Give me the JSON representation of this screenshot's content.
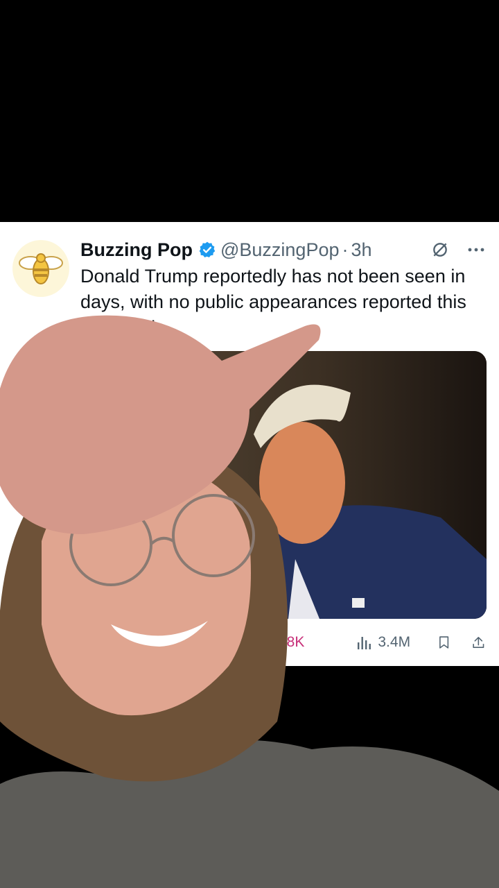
{
  "tweet": {
    "author_name": "Buzzing Pop",
    "handle": "@BuzzingPop",
    "separator": "·",
    "time": "3h",
    "text": "Donald Trump reportedly has not been seen in days, with no public appearances reported this weekend."
  },
  "actions": {
    "likes": "88K",
    "views": "3.4M"
  },
  "icons": {
    "verified": "verified-badge-icon",
    "grok": "grok-icon",
    "more": "more-icon",
    "views": "views-bar-icon",
    "bookmark": "bookmark-icon",
    "share": "share-icon"
  },
  "colors": {
    "accent_blue": "#1d9bf0",
    "like_pink": "#c72e78",
    "secondary_text": "#536471"
  }
}
